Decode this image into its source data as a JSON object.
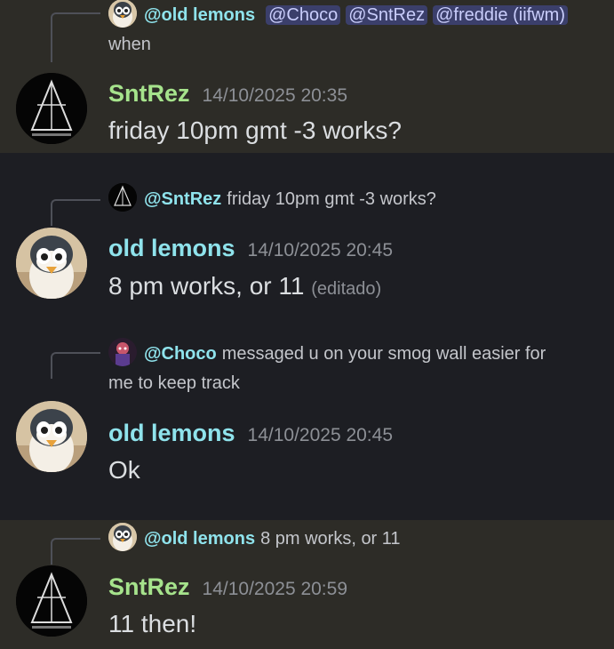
{
  "messages": [
    {
      "reply": {
        "name": "@old lemons",
        "mentions": [
          "@Choco",
          "@SntRez",
          "@freddie (iifwm)"
        ],
        "text": "when"
      },
      "author": "SntRez",
      "timestamp": "14/10/2025 20:35",
      "text": "friday 10pm gmt -3 works?"
    },
    {
      "reply": {
        "name": "@SntRez",
        "text": "friday 10pm gmt -3 works?"
      },
      "author": "old lemons",
      "timestamp": "14/10/2025 20:45",
      "text": "8 pm works, or 11",
      "edited": "(editado)"
    },
    {
      "reply": {
        "name": "@Choco",
        "text": "messaged u on your smog wall easier for",
        "text2": "me to keep track"
      },
      "author": "old lemons",
      "timestamp": "14/10/2025 20:45",
      "text": "Ok"
    },
    {
      "reply": {
        "name": "@old lemons",
        "text": "8 pm works, or 11"
      },
      "author": "SntRez",
      "timestamp": "14/10/2025 20:59",
      "text": "11 then!"
    }
  ],
  "colors": {
    "highlight_bg": "#2d2c27",
    "bg": "#1d1e23",
    "sntrez": "#a6e38c",
    "old_lemons": "#8fe3ec",
    "mention_bg": "#3b3f6b"
  },
  "icons": {
    "sntrez_avatar": "triangle-logo-avatar",
    "lemons_avatar": "penguin-avatar",
    "choco_avatar": "character-avatar"
  }
}
